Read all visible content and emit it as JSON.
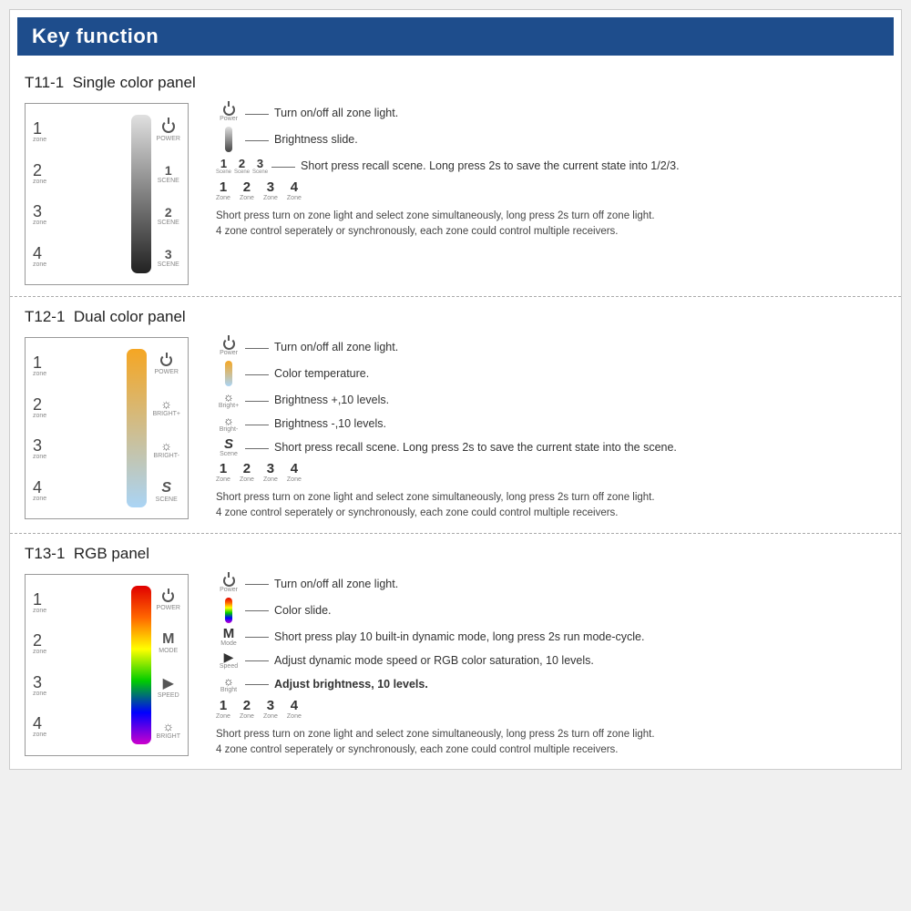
{
  "page": {
    "header": {
      "title": "Key function"
    },
    "sections": [
      {
        "id": "t11",
        "title": "T11-1  Single color panel",
        "panel": {
          "zones": [
            {
              "num": "1",
              "label": "zone"
            },
            {
              "num": "2",
              "label": "zone"
            },
            {
              "num": "3",
              "label": "zone"
            },
            {
              "num": "4",
              "label": "zone"
            }
          ],
          "slider_type": "gray",
          "right_icons": [
            "power",
            "1",
            "2",
            "3"
          ]
        },
        "descriptions": [
          {
            "icon": "power",
            "icon_label": "Power",
            "line": "—",
            "text": "Turn on/off all zone light."
          },
          {
            "icon": "slider_gray",
            "icon_label": "",
            "line": "—",
            "text": "Brightness slide."
          },
          {
            "icon": "scene_123",
            "line": "—",
            "text": "Short press recall scene. Long press 2s to save the current state into 1/2/3."
          }
        ],
        "zone_nums": [
          {
            "num": "1",
            "label": "Zone"
          },
          {
            "num": "2",
            "label": "Zone"
          },
          {
            "num": "3",
            "label": "Zone"
          },
          {
            "num": "4",
            "label": "Zone"
          }
        ],
        "paragraph": "Short press turn on zone light and select zone simultaneously, long press 2s turn off zone light.\n4 zone control seperately or synchronously, each zone could control multiple receivers."
      },
      {
        "id": "t12",
        "title": "T12-1  Dual color panel",
        "panel": {
          "zones": [
            {
              "num": "1",
              "label": "zone"
            },
            {
              "num": "2",
              "label": "zone"
            },
            {
              "num": "3",
              "label": "zone"
            },
            {
              "num": "4",
              "label": "zone"
            }
          ],
          "slider_type": "dual",
          "right_icons": [
            "power",
            "sun_plus",
            "sun_minus",
            "S"
          ]
        },
        "descriptions": [
          {
            "icon": "power",
            "icon_label": "Power",
            "line": "—",
            "text": "Turn on/off all zone light."
          },
          {
            "icon": "slider_dual",
            "icon_label": "",
            "line": "—",
            "text": "Color temperature."
          },
          {
            "icon": "sun_plus",
            "icon_label": "Bright+",
            "line": "—",
            "text": "Brightness +,10 levels."
          },
          {
            "icon": "sun_minus",
            "icon_label": "Bright-",
            "line": "—",
            "text": "Brightness -,10 levels."
          },
          {
            "icon": "S",
            "icon_label": "Scene",
            "line": "—",
            "text": "Short press recall scene. Long press 2s to save the current state into the scene."
          }
        ],
        "zone_nums": [
          {
            "num": "1",
            "label": "Zone"
          },
          {
            "num": "2",
            "label": "Zone"
          },
          {
            "num": "3",
            "label": "Zone"
          },
          {
            "num": "4",
            "label": "Zone"
          }
        ],
        "paragraph": "Short press turn on zone light and select zone simultaneously, long press 2s turn off zone light.\n4 zone control seperately or synchronously, each zone could control multiple receivers."
      },
      {
        "id": "t13",
        "title": "T13-1  RGB panel",
        "panel": {
          "zones": [
            {
              "num": "1",
              "label": "zone"
            },
            {
              "num": "2",
              "label": "zone"
            },
            {
              "num": "3",
              "label": "zone"
            },
            {
              "num": "4",
              "label": "zone"
            }
          ],
          "slider_type": "rgb",
          "right_icons": [
            "power",
            "M",
            "speed",
            "bright"
          ]
        },
        "descriptions": [
          {
            "icon": "power",
            "icon_label": "Power",
            "line": "—",
            "text": "Turn on/off all zone light."
          },
          {
            "icon": "slider_rgb",
            "icon_label": "",
            "line": "—",
            "text": "Color slide."
          },
          {
            "icon": "M",
            "icon_label": "Mode",
            "line": "—",
            "text": "Short press play 10 built-in dynamic mode, long press 2s run mode-cycle."
          },
          {
            "icon": "speed",
            "icon_label": "Speed",
            "line": "—",
            "text": "Adjust dynamic mode speed or RGB color saturation, 10 levels."
          },
          {
            "icon": "bright",
            "icon_label": "Bright",
            "line": "—",
            "text": "Adjust brightness, 10 levels."
          }
        ],
        "zone_nums": [
          {
            "num": "1",
            "label": "Zone"
          },
          {
            "num": "2",
            "label": "Zone"
          },
          {
            "num": "3",
            "label": "Zone"
          },
          {
            "num": "4",
            "label": "Zone"
          }
        ],
        "paragraph": "Short press turn on zone light and select zone simultaneously, long press 2s turn off zone light.\n4 zone control seperately or synchronously, each zone could control multiple receivers."
      }
    ]
  }
}
